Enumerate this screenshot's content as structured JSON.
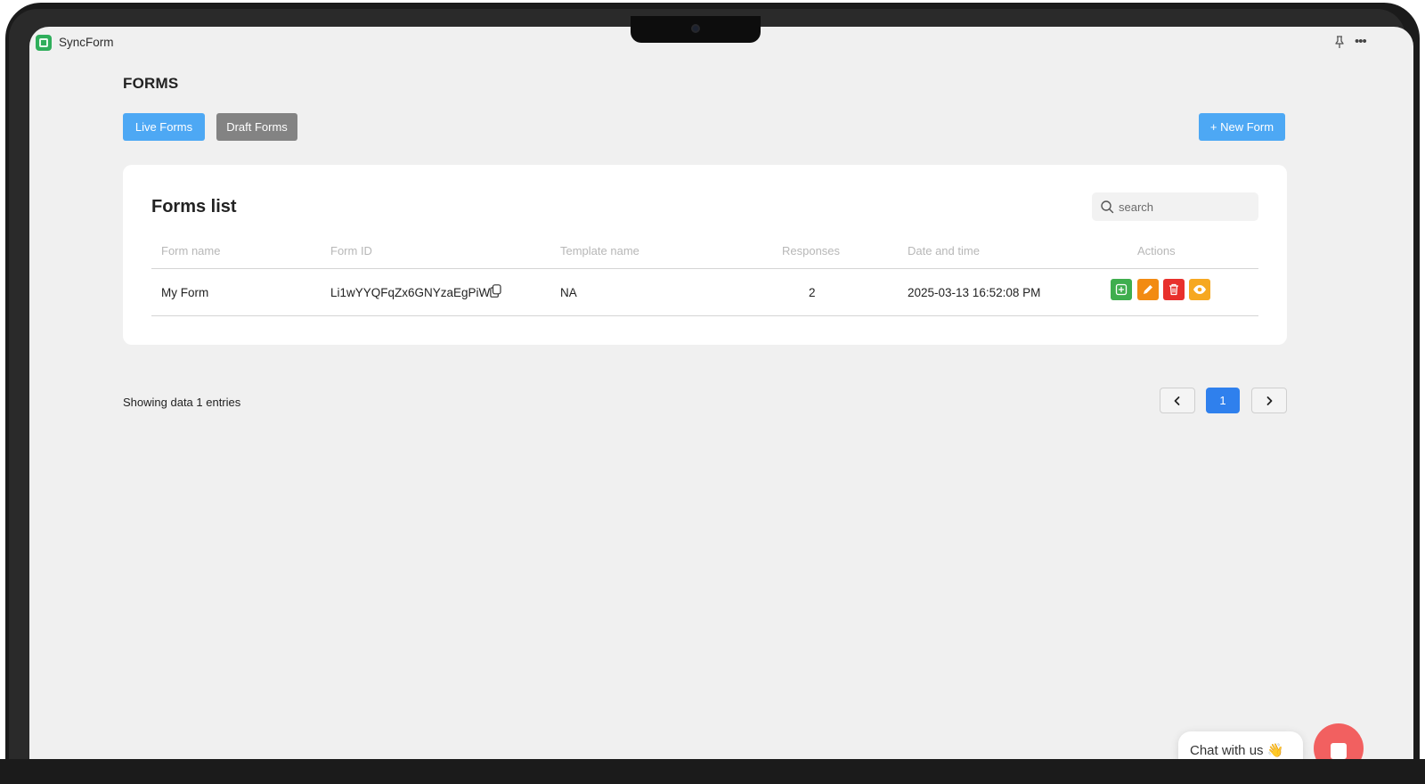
{
  "app": {
    "name": "SyncForm"
  },
  "page": {
    "title": "FORMS"
  },
  "toolbar": {
    "live_label": "Live Forms",
    "draft_label": "Draft Forms",
    "new_label": "+ New Form"
  },
  "card": {
    "title": "Forms list",
    "search_placeholder": "search"
  },
  "table": {
    "headers": [
      "Form name",
      "Form ID",
      "Template name",
      "Responses",
      "Date and time",
      "Actions"
    ],
    "rows": [
      {
        "name": "My Form",
        "id": "Li1wYYQFqZx6GNYzaEgPiW",
        "template": "NA",
        "responses": "2",
        "datetime": "2025-03-13 16:52:08 PM"
      }
    ]
  },
  "footer": {
    "showing": "Showing data 1 entries"
  },
  "pagination": {
    "current": "1"
  },
  "chat": {
    "label": "Chat with us 👋"
  },
  "colors": {
    "primary": "#4da8f4",
    "draft": "#838383",
    "page_active": "#2f80ed",
    "copy": "#3fae4e",
    "edit": "#f28b12",
    "delete": "#e8302c",
    "view": "#f6a821",
    "chat_fab": "#f26060"
  }
}
